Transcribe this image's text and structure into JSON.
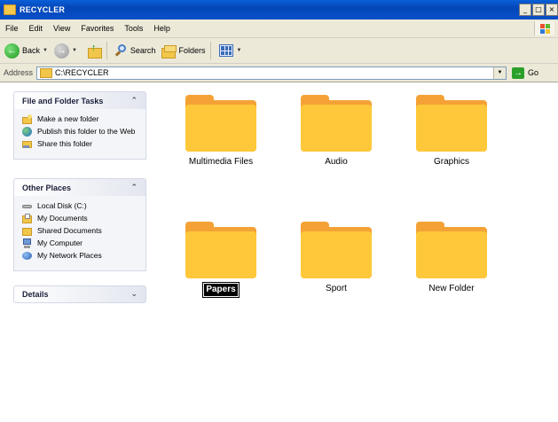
{
  "window": {
    "title": "RECYCLER",
    "minimize": "_",
    "maximize": "□",
    "close": "×"
  },
  "menu": [
    "File",
    "Edit",
    "View",
    "Favorites",
    "Tools",
    "Help"
  ],
  "toolbar": {
    "back": "Back",
    "search": "Search",
    "folders": "Folders"
  },
  "address": {
    "label": "Address",
    "path": "C:\\RECYCLER",
    "go": "Go"
  },
  "tasks": {
    "title": "File and Folder Tasks",
    "items": [
      "Make a new folder",
      "Publish this folder to the Web",
      "Share this folder"
    ]
  },
  "places": {
    "title": "Other Places",
    "items": [
      "Local Disk (C:)",
      "My Documents",
      "Shared Documents",
      "My Computer",
      "My Network Places"
    ]
  },
  "details": {
    "title": "Details"
  },
  "folders": [
    "Multimedia Files",
    "Audio",
    "Graphics",
    "Papers",
    "Sport",
    "New Folder"
  ],
  "selected_folder": "Papers"
}
